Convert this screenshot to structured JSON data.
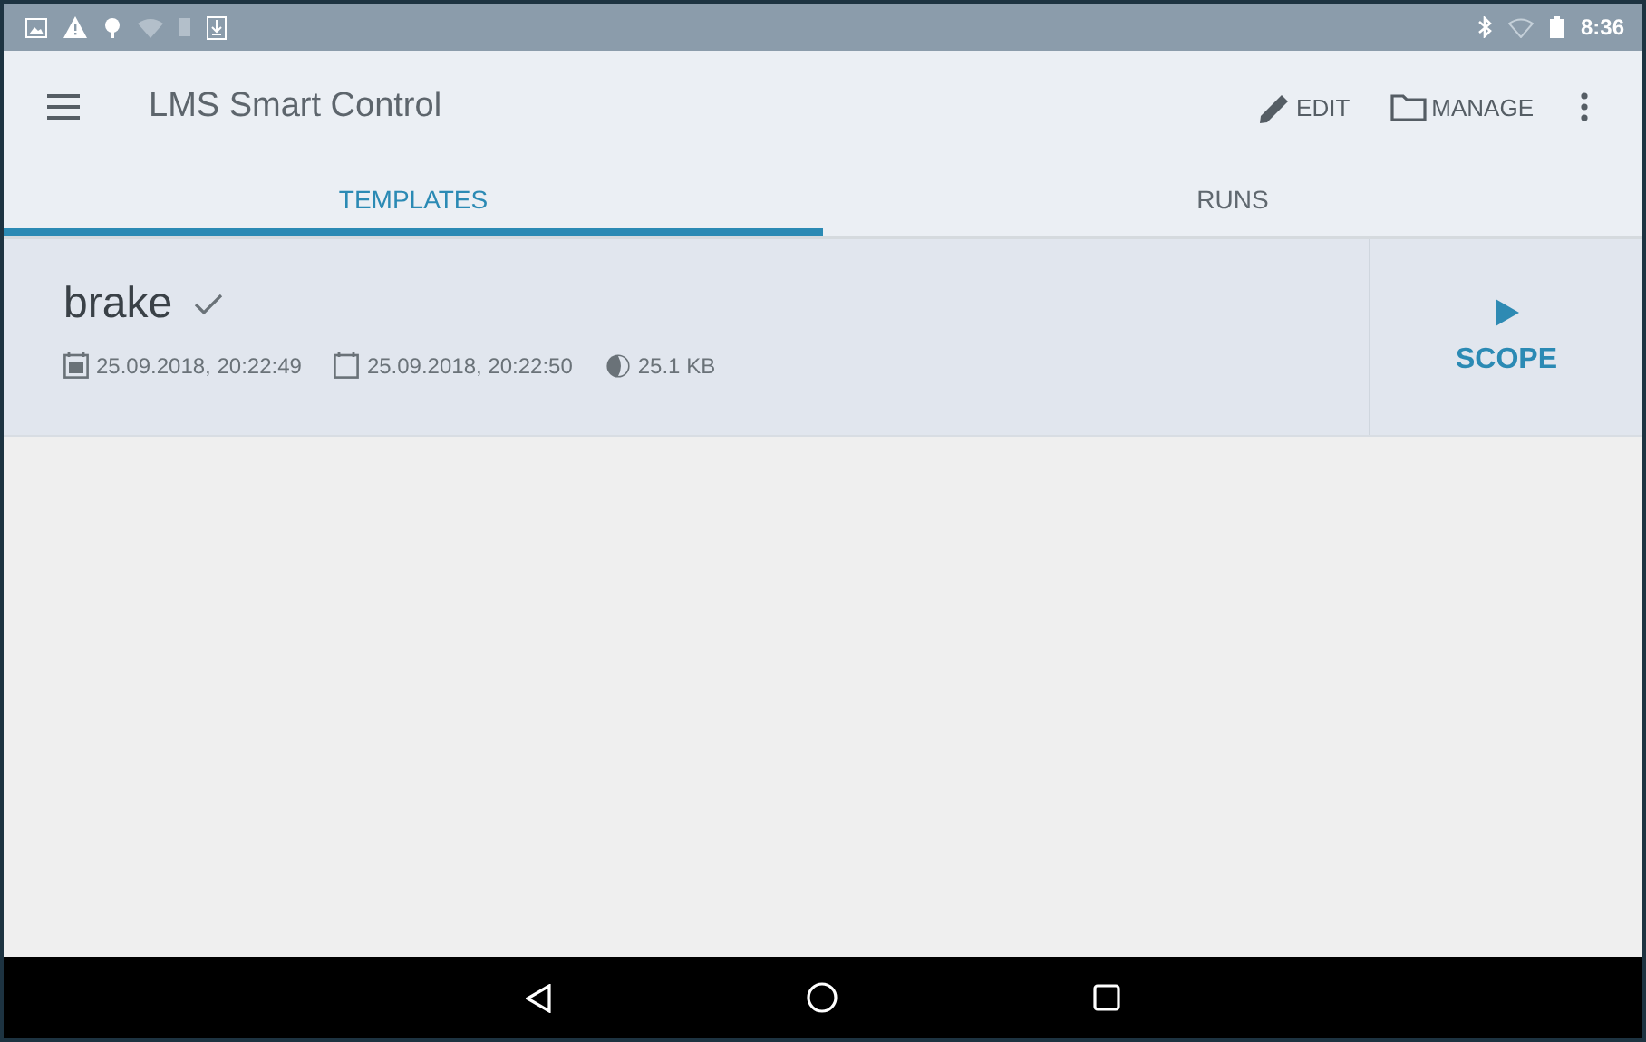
{
  "status_bar": {
    "time": "8:36"
  },
  "app_bar": {
    "title": "LMS Smart Control",
    "actions": [
      {
        "label": "EDIT",
        "kind": "edit"
      },
      {
        "label": "MANAGE",
        "kind": "manage"
      }
    ]
  },
  "tabs": [
    {
      "label": "TEMPLATES",
      "selected": true
    },
    {
      "label": "RUNS",
      "selected": false
    }
  ],
  "templates": [
    {
      "name": "brake",
      "checked": true,
      "created": "25.09.2018, 20:22:49",
      "modified": "25.09.2018, 20:22:50",
      "size": "25.1 KB",
      "action": "SCOPE"
    }
  ]
}
